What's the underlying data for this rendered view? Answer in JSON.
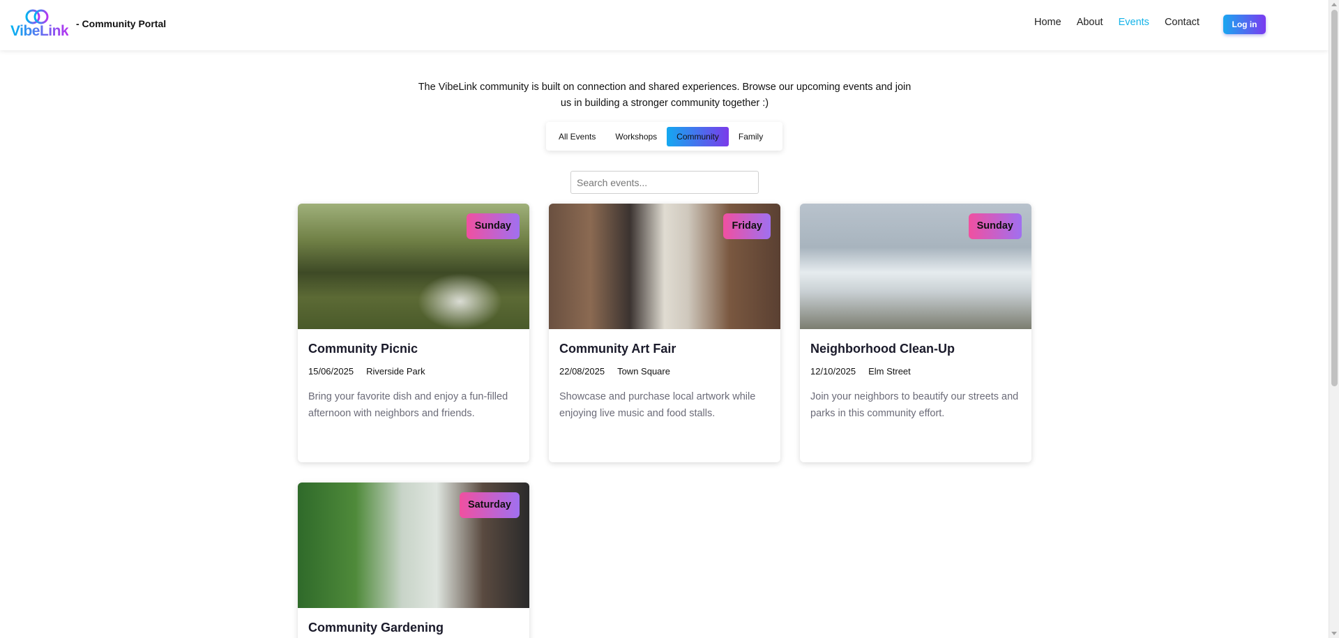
{
  "header": {
    "logo_text": "VibeLink",
    "subtitle": "- Community Portal",
    "nav": [
      {
        "label": "Home",
        "active": false
      },
      {
        "label": "About",
        "active": false
      },
      {
        "label": "Events",
        "active": true
      },
      {
        "label": "Contact",
        "active": false
      }
    ],
    "login_label": "Log in"
  },
  "intro": {
    "text": "The VibeLink community is built on connection and shared experiences. Browse our upcoming events and join us in building a stronger community together :)"
  },
  "filters": [
    {
      "label": "All Events",
      "active": false
    },
    {
      "label": "Workshops",
      "active": false
    },
    {
      "label": "Community",
      "active": true
    },
    {
      "label": "Family",
      "active": false
    }
  ],
  "search": {
    "placeholder": "Search events...",
    "value": ""
  },
  "events": [
    {
      "day": "Sunday",
      "title": "Community Picnic",
      "date": "15/06/2025",
      "location": "Riverside Park",
      "description": "Bring your favorite dish and enjoy a fun-filled afternoon with neighbors and friends.",
      "image": "picnic-photo"
    },
    {
      "day": "Friday",
      "title": "Community Art Fair",
      "date": "22/08/2025",
      "location": "Town Square",
      "description": "Showcase and purchase local artwork while enjoying live music and food stalls.",
      "image": "art-fair-photo"
    },
    {
      "day": "Sunday",
      "title": "Neighborhood Clean-Up",
      "date": "12/10/2025",
      "location": "Elm Street",
      "description": "Join your neighbors to beautify our streets and parks in this community effort.",
      "image": "clean-up-photo"
    },
    {
      "day": "Saturday",
      "title": "Community Gardening",
      "date": "",
      "location": "",
      "description": "",
      "image": "gardening-photo"
    }
  ],
  "colors": {
    "accent": "#14b3e8",
    "gradient_start": "#1aa6f0",
    "gradient_end": "#7a3bf0",
    "badge_start": "#f050a0",
    "badge_end": "#a070f0"
  }
}
